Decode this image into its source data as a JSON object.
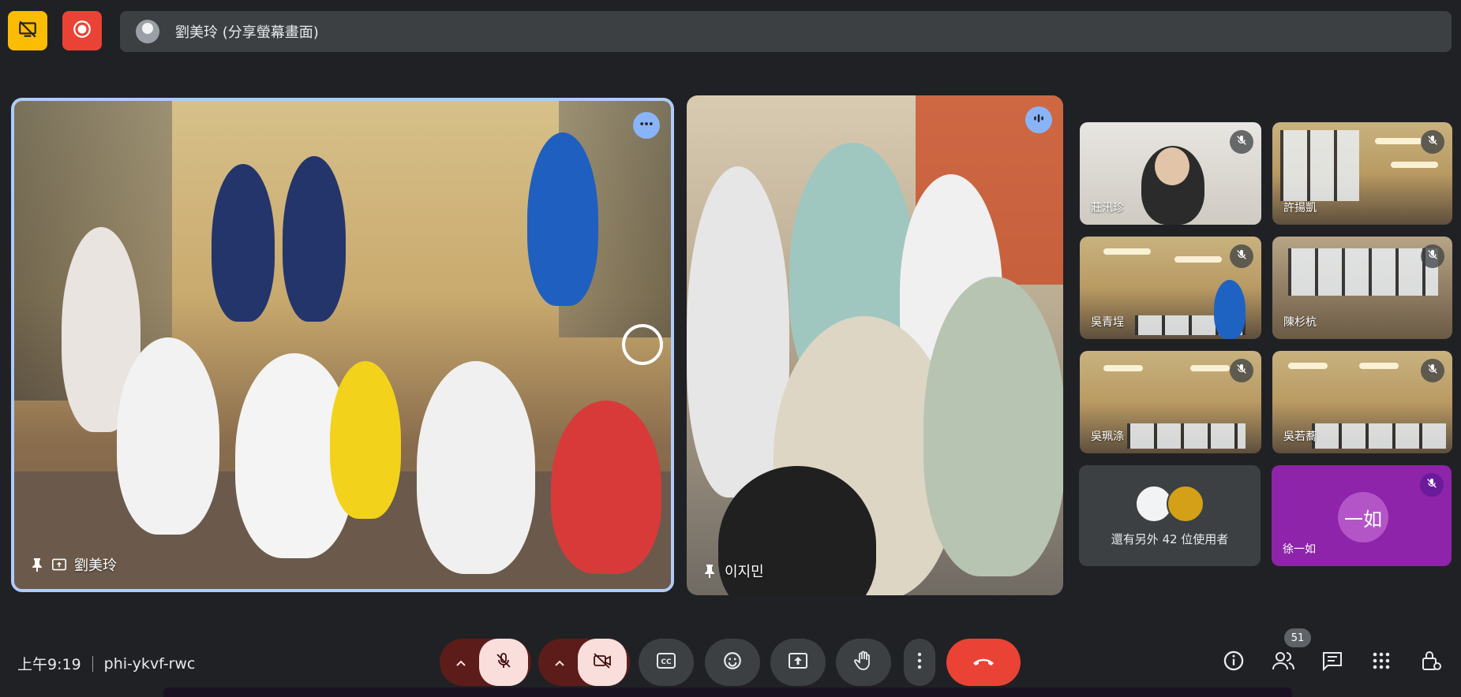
{
  "top_bar": {
    "share_banner_text": "劉美玲 (分享螢幕畫面)"
  },
  "tiles": {
    "main_presenter": {
      "name": "劉美玲"
    },
    "second_presenter": {
      "name": "이지민"
    }
  },
  "participants": [
    {
      "name": "莊汛珍"
    },
    {
      "name": "許揚凱"
    },
    {
      "name": "吳青埕"
    },
    {
      "name": "陳杉杭"
    },
    {
      "name": "吳珮涤"
    },
    {
      "name": "吳若蕎"
    }
  ],
  "others_tile": {
    "text": "還有另外 42 位使用者"
  },
  "avatar_tile": {
    "initials": "一如",
    "name": "徐一如",
    "color": "#8e24aa"
  },
  "bottom_bar": {
    "time": "上午9:19",
    "meeting_code": "phi-ykvf-rwc",
    "participant_count": "51"
  },
  "colors": {
    "background": "#202124",
    "accent_blue": "#8ab4f8",
    "hangup_red": "#ea4335",
    "record_red": "#ea4335",
    "warning_yellow": "#fbbc04"
  },
  "icons": [
    "present-off-icon",
    "record-icon",
    "pin-icon",
    "screen-share-icon",
    "more-vert-icon",
    "audio-level-icon",
    "mic-off-icon",
    "camera-off-icon",
    "chevron-up-icon",
    "captions-icon",
    "emoji-icon",
    "present-icon",
    "raise-hand-icon",
    "hangup-icon",
    "info-icon",
    "people-icon",
    "chat-icon",
    "apps-icon",
    "host-controls-icon"
  ]
}
